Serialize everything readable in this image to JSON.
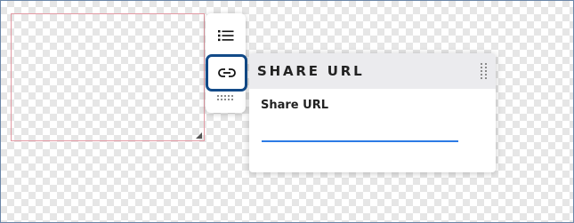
{
  "toolbar": {
    "buttons": [
      {
        "icon": "list-icon",
        "label": ""
      },
      {
        "icon": "link-icon",
        "label": ""
      },
      {
        "icon": "drag-handle-icon",
        "label": ""
      }
    ]
  },
  "share_panel": {
    "title": "SHARE URL",
    "field_label": "Share URL",
    "field_value": "",
    "field_placeholder": ""
  },
  "colors": {
    "active_button_border": "#124a88",
    "input_underline": "#2c7be5",
    "textbox_border": "#e39aa4",
    "panel_header_bg": "#ebebee"
  }
}
